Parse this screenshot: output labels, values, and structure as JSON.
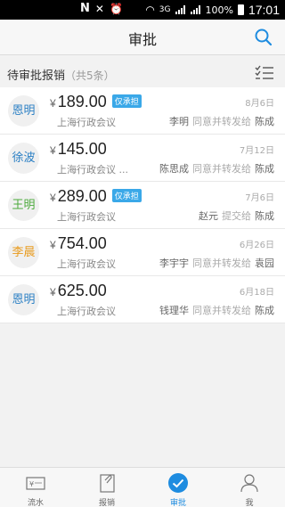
{
  "status_bar": {
    "time": "17:01",
    "battery": "100%",
    "network": "3G"
  },
  "header": {
    "title": "审批"
  },
  "section": {
    "title": "待审批报销",
    "count": "（共5条）"
  },
  "items": [
    {
      "avatar": "恩明",
      "avatar_color": "#2a7fc4",
      "currency": "¥",
      "amount": "189.00",
      "badge": "仅承担",
      "dept": "上海行政会议",
      "date": "8月6日",
      "from": "李明",
      "action": "同意并转发给",
      "to": "陈成"
    },
    {
      "avatar": "徐波",
      "avatar_color": "#2a7fc4",
      "currency": "¥",
      "amount": "145.00",
      "badge": "",
      "dept": "上海行政会议 ...",
      "date": "7月12日",
      "from": "陈思成",
      "action": "同意并转发给",
      "to": "陈成"
    },
    {
      "avatar": "王明",
      "avatar_color": "#4caa3c",
      "currency": "¥",
      "amount": "289.00",
      "badge": "仅承担",
      "dept": "上海行政会议",
      "date": "7月6日",
      "from": "赵元",
      "action": "提交给",
      "to": "陈成"
    },
    {
      "avatar": "李晨",
      "avatar_color": "#e89a1c",
      "currency": "¥",
      "amount": "754.00",
      "badge": "",
      "dept": "上海行政会议",
      "date": "6月26日",
      "from": "李宇宇",
      "action": "同意并转发给",
      "to": "袁园"
    },
    {
      "avatar": "恩明",
      "avatar_color": "#2a7fc4",
      "currency": "¥",
      "amount": "625.00",
      "badge": "",
      "dept": "上海行政会议",
      "date": "6月18日",
      "from": "钱理华",
      "action": "同意并转发给",
      "to": "陈成"
    }
  ],
  "tabs": [
    {
      "label": "流水",
      "icon": "cash-flow-icon"
    },
    {
      "label": "报销",
      "icon": "reimburse-icon"
    },
    {
      "label": "审批",
      "icon": "approve-check-icon",
      "active": true
    },
    {
      "label": "我",
      "icon": "profile-icon"
    }
  ],
  "colors": {
    "accent": "#1e8ce0",
    "badge": "#3aa8e8"
  }
}
